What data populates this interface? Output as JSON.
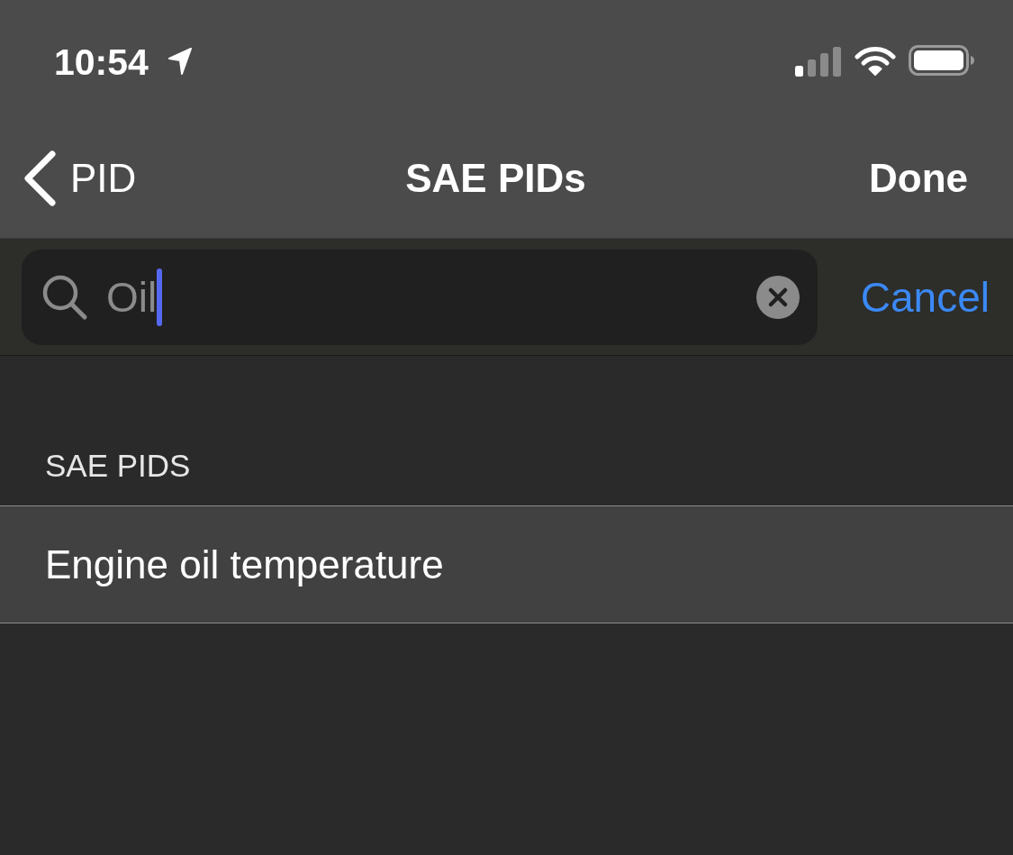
{
  "status_bar": {
    "time": "10:54"
  },
  "nav_bar": {
    "back": "PID",
    "title": "SAE PIDs",
    "action": "Done"
  },
  "search": {
    "value": "Oil",
    "focused": true,
    "cancel": "Cancel"
  },
  "sections": [
    {
      "header": "SAE PIDS",
      "rows": [
        {
          "label": "Engine oil temperature"
        }
      ]
    }
  ]
}
